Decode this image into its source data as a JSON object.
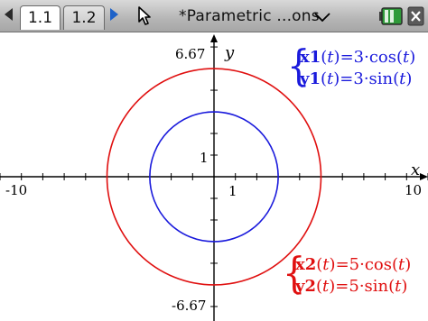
{
  "toolbar": {
    "tabs": [
      {
        "label": "1.1",
        "active": true
      },
      {
        "label": "1.2",
        "active": false
      }
    ],
    "document_title": "*Parametric ...ons",
    "icons": [
      "left-arrow-icon",
      "right-arrow-icon",
      "cursor-icon",
      "chevron-down-icon",
      "battery-icon",
      "close-icon"
    ]
  },
  "graph": {
    "y_max_label": "6.67",
    "y_min_label": "-6.67",
    "x_min_label": "-10",
    "x_max_label": "10",
    "x_unit_label": "1",
    "y_unit_label": "1",
    "x_axis_var": "x",
    "y_axis_var": "y",
    "x_range": [
      -10,
      10
    ],
    "y_range": [
      -6.67,
      6.67
    ],
    "colors": {
      "f1": "#1a1adc",
      "f2": "#e01010"
    }
  },
  "equations": {
    "f1": {
      "x_name": "x1",
      "x_rhs": "=3·cos",
      "y_name": "y1",
      "y_rhs": "=3·sin",
      "param": "t",
      "radius": 3
    },
    "f2": {
      "x_name": "x2",
      "x_rhs": "=5·cos",
      "y_name": "y2",
      "y_rhs": "=5·sin",
      "param": "t",
      "radius": 5
    }
  }
}
